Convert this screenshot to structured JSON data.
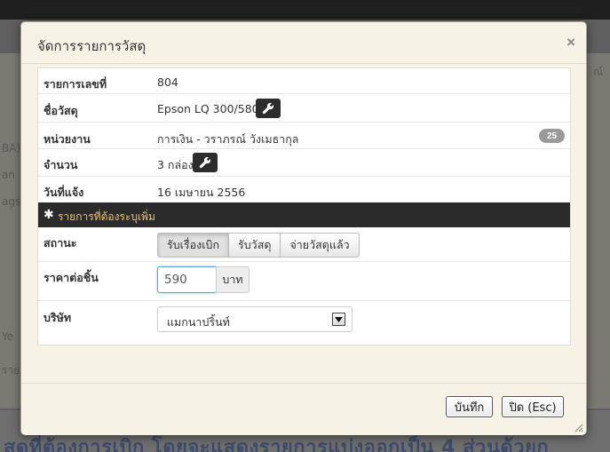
{
  "background": {
    "left_fragments": [
      "BA)",
      "an",
      "ags"
    ],
    "right_fragment": "ณ์",
    "lower_fragments": [
      "Ye",
      "ราย"
    ],
    "bottom_text": "สดุที่ต้องการเบิก โดยจะแสดงรายการแบ่งออกเป็น 4 ส่วนด้วยก"
  },
  "modal": {
    "title": "จัดการรายการวัสดุ",
    "close_symbol": "×",
    "rows": {
      "item_no": {
        "label": "รายการเลขที่",
        "value": "804"
      },
      "material": {
        "label": "ชื่อวัสดุ",
        "value": "Epson LQ 300/580"
      },
      "department": {
        "label": "หน่วยงาน",
        "value": "การเงิน - วราภรณ์ วังเมธากุล",
        "badge": "25"
      },
      "quantity": {
        "label": "จำนวน",
        "value": "3 กล่อง"
      },
      "notify_date": {
        "label": "วันที่แจ้ง",
        "value": "16 เมษายน 2556"
      }
    },
    "section": {
      "star": "✱",
      "title": "รายการที่ต้องระบุเพิ่ม"
    },
    "status": {
      "label": "สถานะ",
      "options": [
        "รับเรื่องเบิก",
        "รับวัสดุ",
        "จ่ายวัสดุแล้ว"
      ],
      "selected": "รับเรื่องเบิก"
    },
    "unit_price": {
      "label": "ราคาต่อชิ้น",
      "value": "590",
      "unit": "บาท"
    },
    "company": {
      "label": "บริษัท",
      "selected": "แมกนาปริ้นท์"
    },
    "footer": {
      "save_label": "บันทึก",
      "close_label": "ปิด (Esc)"
    }
  },
  "icons": [
    "wrench-icon",
    "close-icon",
    "chevron-down-icon",
    "resize-grip-icon"
  ],
  "colors": {
    "section_bar": "#2b2b2b",
    "section_text": "#f0c36d",
    "focus_border": "#5aa3e8",
    "modal_bg": "#f6f2e6"
  }
}
